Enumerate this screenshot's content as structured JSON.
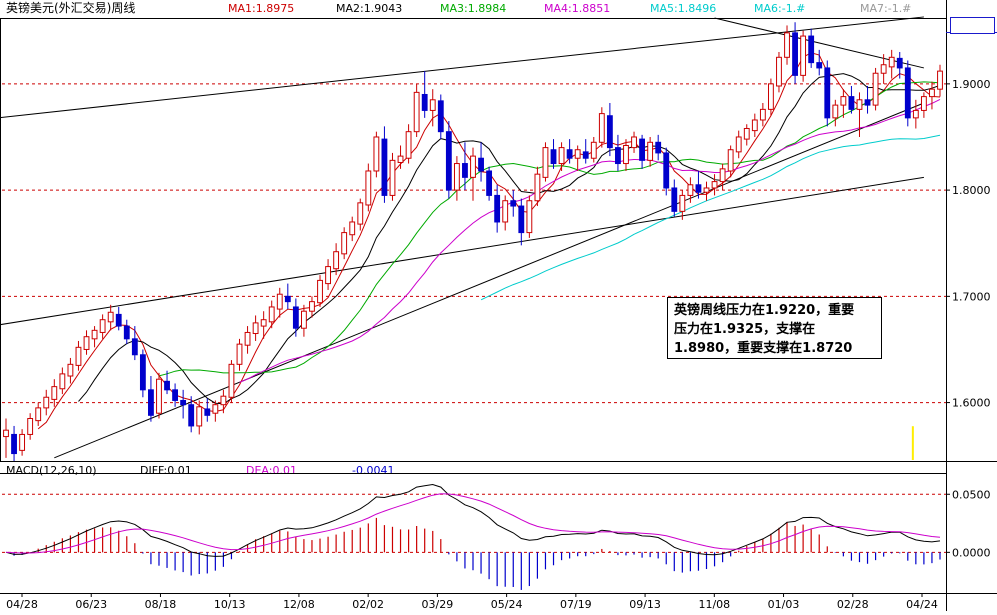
{
  "colors": {
    "ma1": "#cc0000",
    "ma2": "#000000",
    "ma3": "#00aa00",
    "ma4": "#cc00cc",
    "ma5": "#00cccc",
    "ma6": "#0000ff",
    "ma7": "#999999",
    "up": "#cc0000",
    "down": "#0000cc",
    "grid": "#cc0000",
    "diff": "#000000",
    "dea": "#cc00cc",
    "hist_pos": "#cc0000",
    "hist_neg": "#0000cc",
    "volume": "#ffee00",
    "trend": "#000000"
  },
  "header": {
    "title": "英镑美元(外汇交易)周线",
    "ma": [
      {
        "label": "MA1:1.8975",
        "color": "#cc0000"
      },
      {
        "label": "MA2:1.9043",
        "color": "#000000"
      },
      {
        "label": "MA3:1.8984",
        "color": "#00aa00"
      },
      {
        "label": "MA4:1.8851",
        "color": "#cc00cc"
      },
      {
        "label": "MA5:1.8496",
        "color": "#00cccc"
      },
      {
        "label": "MA6:-1.#",
        "color": "#00cccc"
      },
      {
        "label": "MA7:-1.#",
        "color": "#999999"
      }
    ]
  },
  "macd_header": {
    "title": "MACD(12,26,10)",
    "diff": "DIFF:0.01",
    "dea": "DEA:0.01",
    "macd": "-0.0041"
  },
  "annotation": {
    "line1": "英镑周线压力在1.9220，重要",
    "line2": "压力在1.9325，支撑在",
    "line3": "1.8980，重要支撑在1.8720"
  },
  "chart_data": [
    {
      "type": "candlestick",
      "title": "英镑美元(外汇交易)周线",
      "x_tick_labels": [
        "04/28",
        "06/23",
        "08/18",
        "10/13",
        "12/08",
        "02/02",
        "03/29",
        "05/24",
        "07/19",
        "09/13",
        "11/08",
        "01/03",
        "02/28",
        "04/24"
      ],
      "y_ticks": [
        1.6,
        1.7,
        1.8,
        1.9
      ],
      "y_tick_labels": [
        "1.6000",
        "1.7000",
        "1.8000",
        "1.9000"
      ],
      "ylim": [
        1.545,
        1.962
      ],
      "grid": "horizontal dashed at y ticks",
      "candles": [
        [
          1.568,
          1.585,
          1.548,
          1.574
        ],
        [
          1.57,
          1.578,
          1.545,
          1.552
        ],
        [
          1.555,
          1.575,
          1.55,
          1.57
        ],
        [
          1.57,
          1.59,
          1.565,
          1.585
        ],
        [
          1.583,
          1.6,
          1.578,
          1.595
        ],
        [
          1.595,
          1.612,
          1.588,
          1.605
        ],
        [
          1.603,
          1.622,
          1.596,
          1.615
        ],
        [
          1.613,
          1.633,
          1.608,
          1.627
        ],
        [
          1.625,
          1.642,
          1.618,
          1.636
        ],
        [
          1.635,
          1.658,
          1.63,
          1.652
        ],
        [
          1.65,
          1.668,
          1.645,
          1.662
        ],
        [
          1.66,
          1.672,
          1.652,
          1.668
        ],
        [
          1.666,
          1.683,
          1.66,
          1.678
        ],
        [
          1.676,
          1.692,
          1.668,
          1.685
        ],
        [
          1.683,
          1.69,
          1.668,
          1.672
        ],
        [
          1.672,
          1.678,
          1.655,
          1.66
        ],
        [
          1.66,
          1.672,
          1.64,
          1.645
        ],
        [
          1.645,
          1.65,
          1.605,
          1.612
        ],
        [
          1.612,
          1.625,
          1.582,
          1.588
        ],
        [
          1.59,
          1.628,
          1.585,
          1.622
        ],
        [
          1.62,
          1.63,
          1.608,
          1.612
        ],
        [
          1.612,
          1.618,
          1.596,
          1.602
        ],
        [
          1.602,
          1.612,
          1.585,
          1.598
        ],
        [
          1.598,
          1.606,
          1.572,
          1.578
        ],
        [
          1.578,
          1.602,
          1.57,
          1.596
        ],
        [
          1.594,
          1.604,
          1.582,
          1.588
        ],
        [
          1.59,
          1.602,
          1.582,
          1.598
        ],
        [
          1.598,
          1.612,
          1.59,
          1.606
        ],
        [
          1.605,
          1.64,
          1.6,
          1.636
        ],
        [
          1.636,
          1.66,
          1.63,
          1.655
        ],
        [
          1.654,
          1.672,
          1.646,
          1.666
        ],
        [
          1.665,
          1.682,
          1.658,
          1.675
        ],
        [
          1.672,
          1.686,
          1.66,
          1.678
        ],
        [
          1.676,
          1.696,
          1.67,
          1.69
        ],
        [
          1.688,
          1.708,
          1.68,
          1.702
        ],
        [
          1.7,
          1.712,
          1.688,
          1.695
        ],
        [
          1.69,
          1.698,
          1.662,
          1.67
        ],
        [
          1.67,
          1.692,
          1.662,
          1.686
        ],
        [
          1.686,
          1.7,
          1.68,
          1.695
        ],
        [
          1.694,
          1.72,
          1.69,
          1.715
        ],
        [
          1.712,
          1.735,
          1.706,
          1.728
        ],
        [
          1.726,
          1.75,
          1.72,
          1.742
        ],
        [
          1.74,
          1.765,
          1.735,
          1.76
        ],
        [
          1.758,
          1.775,
          1.752,
          1.77
        ],
        [
          1.768,
          1.792,
          1.762,
          1.788
        ],
        [
          1.786,
          1.825,
          1.78,
          1.818
        ],
        [
          1.818,
          1.855,
          1.812,
          1.85
        ],
        [
          1.848,
          1.86,
          1.788,
          1.795
        ],
        [
          1.795,
          1.835,
          1.79,
          1.828
        ],
        [
          1.826,
          1.842,
          1.82,
          1.832
        ],
        [
          1.83,
          1.862,
          1.825,
          1.855
        ],
        [
          1.855,
          1.9,
          1.85,
          1.892
        ],
        [
          1.89,
          1.912,
          1.868,
          1.875
        ],
        [
          1.875,
          1.895,
          1.86,
          1.885
        ],
        [
          1.884,
          1.89,
          1.848,
          1.855
        ],
        [
          1.855,
          1.865,
          1.792,
          1.8
        ],
        [
          1.8,
          1.832,
          1.79,
          1.825
        ],
        [
          1.825,
          1.845,
          1.8,
          1.812
        ],
        [
          1.812,
          1.84,
          1.79,
          1.832
        ],
        [
          1.83,
          1.845,
          1.808,
          1.818
        ],
        [
          1.818,
          1.822,
          1.79,
          1.795
        ],
        [
          1.795,
          1.805,
          1.76,
          1.77
        ],
        [
          1.77,
          1.795,
          1.762,
          1.79
        ],
        [
          1.79,
          1.8,
          1.775,
          1.785
        ],
        [
          1.785,
          1.792,
          1.748,
          1.76
        ],
        [
          1.76,
          1.795,
          1.755,
          1.79
        ],
        [
          1.79,
          1.822,
          1.785,
          1.815
        ],
        [
          1.812,
          1.845,
          1.808,
          1.84
        ],
        [
          1.838,
          1.848,
          1.82,
          1.825
        ],
        [
          1.825,
          1.845,
          1.818,
          1.84
        ],
        [
          1.838,
          1.848,
          1.825,
          1.83
        ],
        [
          1.83,
          1.842,
          1.818,
          1.838
        ],
        [
          1.836,
          1.848,
          1.825,
          1.83
        ],
        [
          1.83,
          1.85,
          1.826,
          1.845
        ],
        [
          1.845,
          1.878,
          1.84,
          1.872
        ],
        [
          1.87,
          1.882,
          1.832,
          1.84
        ],
        [
          1.84,
          1.852,
          1.818,
          1.825
        ],
        [
          1.825,
          1.848,
          1.818,
          1.842
        ],
        [
          1.84,
          1.855,
          1.835,
          1.85
        ],
        [
          1.848,
          1.852,
          1.82,
          1.828
        ],
        [
          1.828,
          1.85,
          1.822,
          1.845
        ],
        [
          1.845,
          1.852,
          1.828,
          1.835
        ],
        [
          1.835,
          1.84,
          1.795,
          1.802
        ],
        [
          1.802,
          1.81,
          1.775,
          1.78
        ],
        [
          1.78,
          1.8,
          1.772,
          1.795
        ],
        [
          1.795,
          1.812,
          1.788,
          1.805
        ],
        [
          1.805,
          1.818,
          1.792,
          1.798
        ],
        [
          1.798,
          1.808,
          1.79,
          1.802
        ],
        [
          1.802,
          1.815,
          1.795,
          1.808
        ],
        [
          1.808,
          1.825,
          1.8,
          1.82
        ],
        [
          1.818,
          1.842,
          1.812,
          1.838
        ],
        [
          1.836,
          1.856,
          1.83,
          1.85
        ],
        [
          1.848,
          1.862,
          1.842,
          1.858
        ],
        [
          1.856,
          1.872,
          1.85,
          1.866
        ],
        [
          1.866,
          1.882,
          1.86,
          1.876
        ],
        [
          1.876,
          1.905,
          1.87,
          1.9
        ],
        [
          1.898,
          1.93,
          1.892,
          1.925
        ],
        [
          1.925,
          1.955,
          1.918,
          1.948
        ],
        [
          1.948,
          1.958,
          1.9,
          1.908
        ],
        [
          1.908,
          1.95,
          1.902,
          1.945
        ],
        [
          1.945,
          1.952,
          1.915,
          1.92
        ],
        [
          1.92,
          1.932,
          1.908,
          1.915
        ],
        [
          1.915,
          1.922,
          1.86,
          1.868
        ],
        [
          1.868,
          1.885,
          1.86,
          1.88
        ],
        [
          1.88,
          1.895,
          1.868,
          1.888
        ],
        [
          1.888,
          1.898,
          1.872,
          1.876
        ],
        [
          1.876,
          1.892,
          1.85,
          1.885
        ],
        [
          1.885,
          1.898,
          1.872,
          1.88
        ],
        [
          1.88,
          1.915,
          1.875,
          1.91
        ],
        [
          1.91,
          1.928,
          1.9,
          1.918
        ],
        [
          1.916,
          1.932,
          1.905,
          1.925
        ],
        [
          1.924,
          1.93,
          1.905,
          1.915
        ],
        [
          1.915,
          1.922,
          1.86,
          1.868
        ],
        [
          1.868,
          1.885,
          1.858,
          1.875
        ],
        [
          1.875,
          1.892,
          1.868,
          1.888
        ],
        [
          1.888,
          1.902,
          1.876,
          1.895
        ],
        [
          1.895,
          1.918,
          1.888,
          1.912
        ]
      ],
      "moving_averages": [
        {
          "name": "MA1",
          "period": 5,
          "color": "#cc0000"
        },
        {
          "name": "MA2",
          "period": 10,
          "color": "#000000"
        },
        {
          "name": "MA3",
          "period": 20,
          "color": "#00aa00"
        },
        {
          "name": "MA4",
          "period": 30,
          "color": "#cc00cc"
        },
        {
          "name": "MA5",
          "period": 60,
          "color": "#00cccc"
        }
      ],
      "trendlines": [
        {
          "x1": -1,
          "y1": 1.868,
          "x2": 114,
          "y2": 1.963
        },
        {
          "x1": -1,
          "y1": 1.673,
          "x2": 114,
          "y2": 1.812
        },
        {
          "x1": 6,
          "y1": 1.548,
          "x2": 114,
          "y2": 1.882
        },
        {
          "x1": 88,
          "y1": 1.962,
          "x2": 114,
          "y2": 1.915
        }
      ],
      "volume_bar": {
        "index": 113,
        "value": 0.6
      }
    },
    {
      "type": "bar+line",
      "title": "MACD(12,26,10)",
      "y_ticks": [
        0.0,
        0.05
      ],
      "y_tick_labels": [
        "0.0000",
        "0.0500"
      ],
      "ylim": [
        -0.035,
        0.064
      ]
    }
  ]
}
